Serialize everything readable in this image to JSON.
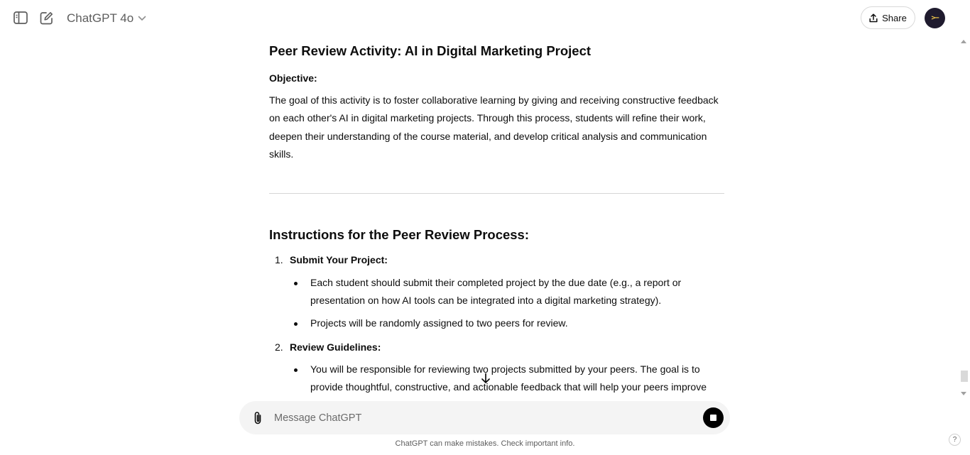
{
  "header": {
    "model_name": "ChatGPT 4o",
    "share_label": "Share",
    "avatar_text": ">−"
  },
  "content": {
    "title": "Peer Review Activity: AI in Digital Marketing Project",
    "objective_label": "Objective:",
    "objective_text": "The goal of this activity is to foster collaborative learning by giving and receiving constructive feedback on each other's AI in digital marketing projects. Through this process, students will refine their work, deepen their understanding of the course material, and develop critical analysis and communication skills.",
    "instructions_title": "Instructions for the Peer Review Process:",
    "steps": [
      {
        "number": "1.",
        "heading": "Submit Your Project:",
        "bullets": [
          "Each student should submit their completed project by the due date (e.g., a report or presentation on how AI tools can be integrated into a digital marketing strategy).",
          "Projects will be randomly assigned to two peers for review."
        ]
      },
      {
        "number": "2.",
        "heading": "Review Guidelines:",
        "bullets": [
          "You will be responsible for reviewing two projects submitted by your peers. The goal is to provide thoughtful, constructive, and actionable feedback that will help your peers improve"
        ]
      }
    ]
  },
  "composer": {
    "placeholder": "Message ChatGPT"
  },
  "footer_note": "ChatGPT can make mistakes. Check important info.",
  "help_label": "?",
  "colors": {
    "stop_button": "#000000",
    "composer_bg": "#f4f4f4",
    "avatar_bg": "#1f1b2e"
  }
}
